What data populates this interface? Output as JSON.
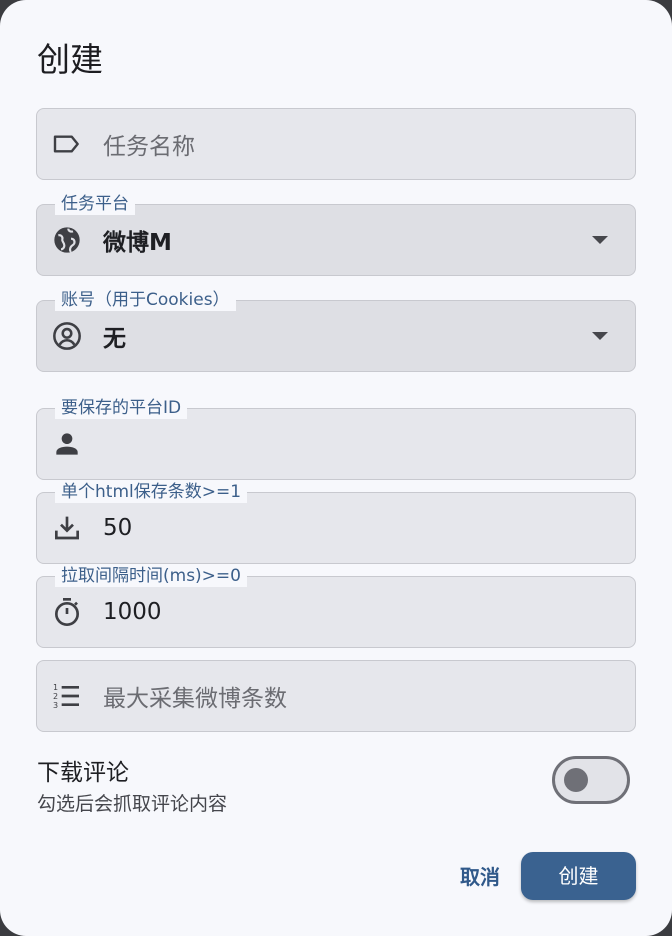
{
  "dialog": {
    "title": "创建"
  },
  "fields": {
    "task_name": {
      "placeholder": "任务名称",
      "icon": "label-icon"
    },
    "platform": {
      "label": "任务平台",
      "value": "微博M",
      "icon": "globe-icon"
    },
    "account": {
      "label": "账号（用于Cookies）",
      "value": "无",
      "icon": "account-circle-icon"
    },
    "platform_id": {
      "label": "要保存的平台ID",
      "value": "",
      "icon": "person-icon"
    },
    "per_html": {
      "label": "单个html保存条数>=1",
      "value": "50",
      "icon": "download-icon"
    },
    "interval": {
      "label": "拉取间隔时间(ms)>=0",
      "value": "1000",
      "icon": "timer-icon"
    },
    "max_count": {
      "placeholder": "最大采集微博条数",
      "icon": "numbered-list-icon"
    }
  },
  "download_comments": {
    "title": "下载评论",
    "subtitle": "勾选后会抓取评论内容",
    "enabled": false
  },
  "actions": {
    "cancel_label": "取消",
    "create_label": "创建"
  },
  "colors": {
    "accent": "#3a6290",
    "label": "#3c5f8a",
    "dialog_bg": "#f7f8fc"
  }
}
